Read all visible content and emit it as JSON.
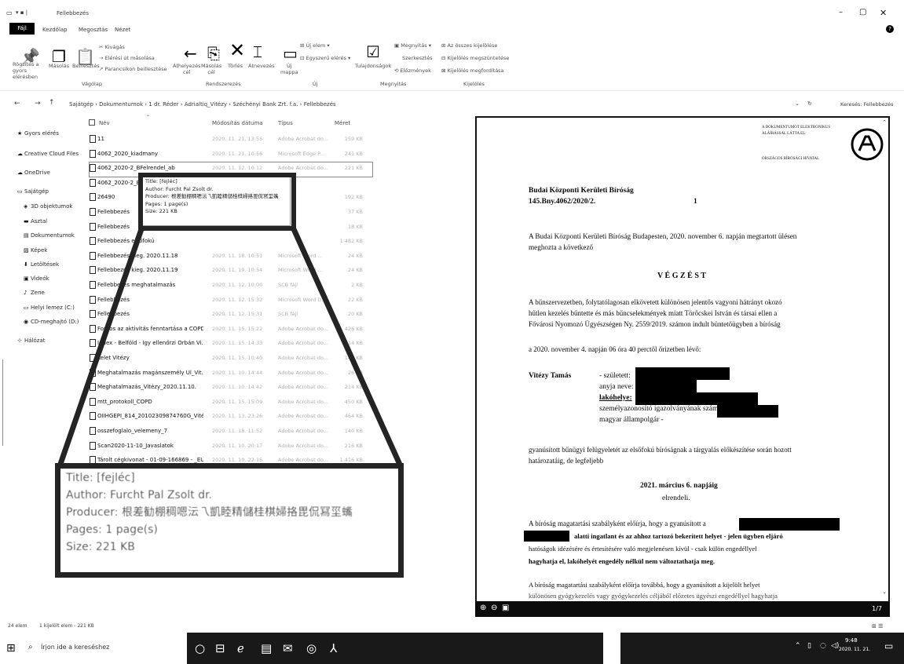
{
  "window": {
    "title": "Fellebbezés",
    "minimize": "–",
    "maximize": "▢",
    "close": "✕",
    "help": "?"
  },
  "menu": {
    "file": "Fájl",
    "tabs": [
      "Kezdőlap",
      "Megosztás",
      "Nézet"
    ]
  },
  "ribbon": {
    "clipboard": {
      "pin": "Rögzítés a\ngyors elérésben",
      "copy": "Másolás",
      "paste": "Beillesztés",
      "cut": "Kivágás",
      "copy_path": "Elérési út másolása",
      "paste_shortcut": "Parancsikon beillesztése",
      "group": "Vágólap"
    },
    "organize": {
      "move": "Áthelyezés\ncél",
      "copy_to": "Másolás\ncél",
      "delete": "Törlés",
      "rename": "Átnevezés",
      "group": "Rendszerezés"
    },
    "new": {
      "new_folder": "Új\nmappa",
      "new_item": "Új elem",
      "easy_access": "Egyszerű elérés",
      "group": "Új"
    },
    "open": {
      "properties": "Tulajdonságok",
      "open": "Megnyitás",
      "edit": "Szerkesztés",
      "history": "Előzmények",
      "group": "Megnyitás"
    },
    "select": {
      "all": "Az összes kijelölése",
      "none": "Kijelölés megszüntetése",
      "invert": "Kijelölés megfordítása",
      "group": "Kijelölés"
    }
  },
  "address": {
    "path": [
      "Sajátgép",
      "Dokumentumok",
      "1 dr. Réder",
      "Adrialtiq_Vitézy",
      "Széchényi Bank Zrt. f.a.",
      "Fellebbezés"
    ],
    "search_placeholder": "Keresés: Fellebbezés"
  },
  "nav": [
    {
      "label": "Gyors elérés",
      "icon": "star-icon"
    },
    {
      "label": "Creative Cloud Files",
      "icon": "cloud-icon"
    },
    {
      "label": "OneDrive",
      "icon": "cloud-icon"
    },
    {
      "label": "Sajátgép",
      "icon": "computer-icon"
    },
    {
      "label": "3D objektumok",
      "icon": "cube-icon"
    },
    {
      "label": "Asztal",
      "icon": "desktop-icon"
    },
    {
      "label": "Dokumentumok",
      "icon": "document-icon"
    },
    {
      "label": "Képek",
      "icon": "image-icon"
    },
    {
      "label": "Letöltések",
      "icon": "download-icon"
    },
    {
      "label": "Videók",
      "icon": "video-icon"
    },
    {
      "label": "Zene",
      "icon": "music-icon"
    },
    {
      "label": "Helyi lemez (C:)",
      "icon": "drive-icon"
    },
    {
      "label": "CD-meghajtó (D:)",
      "icon": "disc-icon"
    },
    {
      "label": "Hálózat",
      "icon": "network-icon"
    }
  ],
  "columns": {
    "name": "Név",
    "date": "Módosítás dátuma",
    "type": "Típus",
    "size": "Méret"
  },
  "files": [
    {
      "name": "11",
      "date": "2020. 11. 21. 13:55",
      "type": "Adobe Acrobat do...",
      "size": "159 KB"
    },
    {
      "name": "4062_2020_kiadmany",
      "date": "2020. 11. 21. 10:56",
      "type": "Microsoft Edge P...",
      "size": "241 KB"
    },
    {
      "name": "4062_2020-2_BFelrendel_ab",
      "date": "2020. 11. 12. 10:12",
      "type": "Adobe Acrobat do...",
      "size": "221 KB"
    },
    {
      "name": "4062_2020-2_BFelrendel_al",
      "date": "",
      "type": "",
      "size": ""
    },
    {
      "name": "26490",
      "date": "",
      "type": "",
      "size": "192 KB"
    },
    {
      "name": "Fellebbezés",
      "date": "",
      "type": "",
      "size": "37 KB"
    },
    {
      "name": "Fellebbezés",
      "date": "",
      "type": "",
      "size": "18 KB"
    },
    {
      "name": "Fellebbezés elsőfokú",
      "date": "",
      "type": "",
      "size": "1 482 KB"
    },
    {
      "name": "Fellebbezés kieg. 2020.11.18",
      "date": "2020. 11. 18. 10:51",
      "type": "Microsoft Word ...",
      "size": "24 KB"
    },
    {
      "name": "Fellebbezés kieg. 2020.11.19",
      "date": "2020. 11. 19. 10:54",
      "type": "Microsoft Word ...",
      "size": "24 KB"
    },
    {
      "name": "Fellebbezés meghatalmazás",
      "date": "2020. 11. 12. 10:00",
      "type": "SCB fájl",
      "size": "2 KB"
    },
    {
      "name": "Fellebbezés",
      "date": "2020. 11. 12. 15:32",
      "type": "Microsoft Word D...",
      "size": "22 KB"
    },
    {
      "name": "Fellebbezés",
      "date": "2020. 11. 12. 15:31",
      "type": "SCB fájl",
      "size": "20 KB"
    },
    {
      "name": "Fontos az aktivitás fenntartása a COPD...",
      "date": "2020. 11. 15. 15:22",
      "type": "Adobe Acrobat do...",
      "size": "426 KB"
    },
    {
      "name": "Index - Belföld - Így ellenőrzi Orbán Vi...",
      "date": "2020. 11. 15. 14:33",
      "type": "Adobe Acrobat do...",
      "size": "314 KB"
    },
    {
      "name": "Lelet Vitézy",
      "date": "2020. 11. 15. 10:40",
      "type": "Adobe Acrobat do...",
      "size": "141 KB"
    },
    {
      "name": "Meghatalmazás magánszemély Ül_Vit...",
      "date": "2020. 11. 10. 14:44",
      "type": "Adobe Acrobat do...",
      "size": "26 KB"
    },
    {
      "name": "Meghatalmazás_Vitézy_2020.11.10.",
      "date": "2020. 11. 10. 14:42",
      "type": "Adobe Acrobat do...",
      "size": "214 KB"
    },
    {
      "name": "mtt_protokoll_COPD",
      "date": "2020. 11. 15. 15:09",
      "type": "Adobe Acrobat do...",
      "size": "450 KB"
    },
    {
      "name": "OIIHGEPI_814_20102309874760G_Vitéz...",
      "date": "2020. 11. 13. 23:26",
      "type": "Adobe Acrobat do...",
      "size": "464 KB"
    },
    {
      "name": "osszefoglalo_velemeny_7",
      "date": "2020. 11. 18. 11:52",
      "type": "Adobe Acrobat do...",
      "size": "140 KB"
    },
    {
      "name": "Scan2020-11-10_Javaslatok",
      "date": "2020. 11. 10. 20:17",
      "type": "Adobe Acrobat do...",
      "size": "216 KB"
    },
    {
      "name": "Tárolt cégkivonat - 01-09-166869 - _EU...",
      "date": "2020. 11. 10. 22:15",
      "type": "Adobe Acrobat do...",
      "size": "1 416 KB"
    },
    {
      "name": "Vitézy bűnügyi felügyelet_Fellebbezés...",
      "date": "2020. 11. 10. 22:15",
      "type": "Adobe Acrobat do...",
      "size": "1 417 KB"
    }
  ],
  "tooltip": {
    "title": "Title: [fejléc]",
    "author": "Author: Furcht Pal Zsolt dr.",
    "producer": "Producer: 根差勧棚稠嗯沄乁凱睦精儲桂棋婦挌毘侃冩坙蟕",
    "pages": "Pages: 1 page(s)",
    "size": "Size: 221 KB"
  },
  "zoom": {
    "title": "Title: [fejléc]",
    "author": "Author: Furcht Pal Zsolt dr.",
    "producer": "Producer: 根差勧棚稠嗯沄乁凱睦精儲桂棋婦挌毘侃冩坙蟕",
    "pages": "Pages: 1 page(s)",
    "size": "Size: 221 KB"
  },
  "doc": {
    "stamp1": "A DOKUMENTUMOT ELEKTRONIKUS",
    "stamp2": "ALÁÍRÁSSAL LÁTTA EL:",
    "stamp3": "ORSZÁGOS BÍRÓSÁGI HIVATAL",
    "court": "Budai Központi Kerületi Bíróság",
    "case": "145.Bny.4062/2020/2.",
    "page": "1",
    "p1a": "A Budai Központi Kerületi Bíróság Budapesten, 2020. november 6. napján megtartott ülésen",
    "p1b": "meghozta a következő",
    "heading": "V É G Z É S T",
    "p2a": "A bűnszervezetben, folytatólagosan elkövetett különösen jelentős vagyoni hátrányt okozó",
    "p2b": "hűtlen kezelés bűntette és más bűncselekmények miatt Törőcskei István és társai ellen a",
    "p2c": "Fővárosi Nyomozó Ügyészségen Ny. 2559/2019. számon indult büntetőügyben a bíróság",
    "p3": "a 2020. november 4. napján 06 óra 40 perctől őrizetben lévő:",
    "name": "Vitézy Tamás",
    "born": "- született:",
    "mother": "anyja neve:",
    "home": "lakóhelye:",
    "idcard": "személyazonosító igazolványának száma:",
    "citizen": "magyar állampolgár -",
    "p4a": "gyanúsított bűnügyi felügyeletét az elsőfokú bíróságnak a tárgyalás előkészítése során hozott",
    "p4b": "határozatáig, de legfeljebb",
    "date": "2021. március 6. napjáig",
    "ordered": "elrendeli.",
    "p5a": "A bíróság magatartási szabályként előírja, hogy a gyanúsított a",
    "p5b": "alatti ingatlant és az ahhoz tartozó bekerített helyet - jelen ügyben eljáró",
    "p5c": "hatóságok idézésére és értesítésére való megjelenésen kívül - csak külön engedéllyel",
    "p5d": "hagyhatja el, lakóhelyét engedély nélkül nem változtathatja meg.",
    "p6a": "A bíróság magatartási szabályként előírja továbbá, hogy a gyanúsított a kijelölt helyet",
    "p6b": "különösen gyógykezelés vagy gyógykezelés céljából előzetes ügyészi engedéllyel hagyhatja",
    "pagecount": "1/7"
  },
  "status": {
    "items": "24 elem",
    "selected": "1 kijelölt elem - 221 KB"
  },
  "taskbar": {
    "search": "Írjon ide a kereséshez",
    "time": "9:48",
    "date": "2020. 11. 21."
  }
}
